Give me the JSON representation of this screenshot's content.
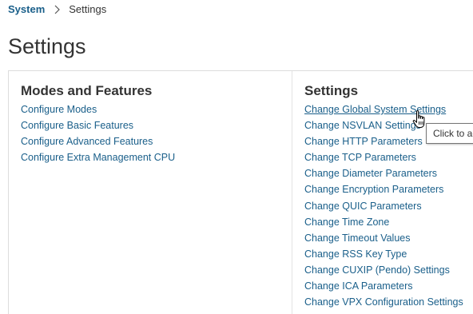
{
  "breadcrumb": {
    "root": "System",
    "current": "Settings"
  },
  "page_title": "Settings",
  "modes_section": {
    "title": "Modes and Features",
    "links": [
      "Configure Modes",
      "Configure Basic Features",
      "Configure Advanced Features",
      "Configure Extra Management CPU"
    ]
  },
  "settings_section": {
    "title": "Settings",
    "links": [
      "Change Global System Settings",
      "Change NSVLAN Settings",
      "Change HTTP Parameters",
      "Change TCP Parameters",
      "Change Diameter Parameters",
      "Change Encryption Parameters",
      "Change QUIC Parameters",
      "Change Time Zone",
      "Change Timeout Values",
      "Change RSS Key Type",
      "Change CUXIP (Pendo) Settings",
      "Change ICA Parameters",
      "Change VPX Configuration Settings"
    ]
  },
  "tooltip": "Click to ac",
  "colors": {
    "link": "#1a5f8a",
    "text": "#333333",
    "border": "#dcdcdc"
  },
  "icons": {
    "breadcrumb_separator": "chevron-right-icon",
    "pointer": "hand-pointer-cursor-icon"
  }
}
